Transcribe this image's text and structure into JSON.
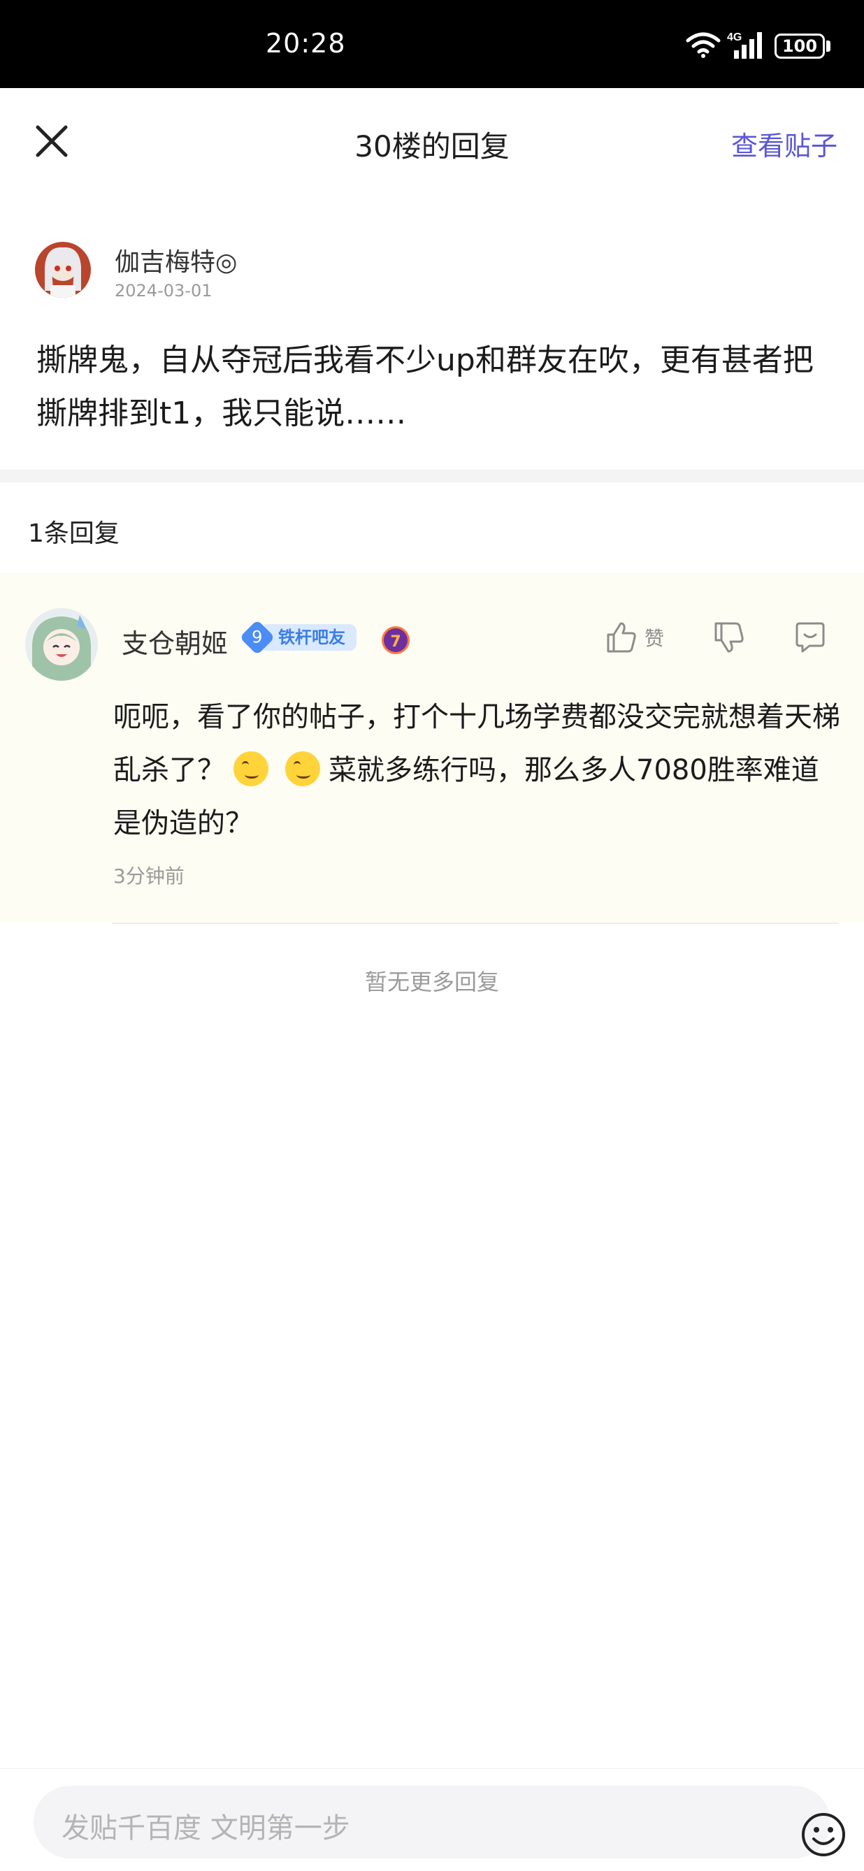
{
  "status_bar": {
    "time": "20:28",
    "network": "4G",
    "battery": "100"
  },
  "header": {
    "title": "30楼的回复",
    "view_post": "查看贴子"
  },
  "post": {
    "author": "伽吉梅特◎",
    "date": "2024-03-01",
    "content": "撕牌鬼，自从夺冠后我看不少up和群友在吹，更有甚者把撕牌排到t1，我只能说……"
  },
  "replies": {
    "count_label": "1条回复",
    "items": [
      {
        "author": "支仓朝姬",
        "level": "9",
        "level_title": "铁杆吧友",
        "medal": "7",
        "like_label": "赞",
        "content_part1": "呃呃，看了你的帖子，打个十几场学费都没交完就想着天梯乱杀了？",
        "content_part2": "菜就多练行吗，那么多人7080胜率难道是伪造的？",
        "emoji": "smirk-emoji",
        "time": "3分钟前"
      }
    ],
    "no_more": "暂无更多回复"
  },
  "composer": {
    "placeholder": "发贴千百度  文明第一步"
  },
  "colors": {
    "accent": "#5a55d6",
    "reply_bg": "#fefdf3",
    "badge_blue": "#4b8cf7"
  }
}
